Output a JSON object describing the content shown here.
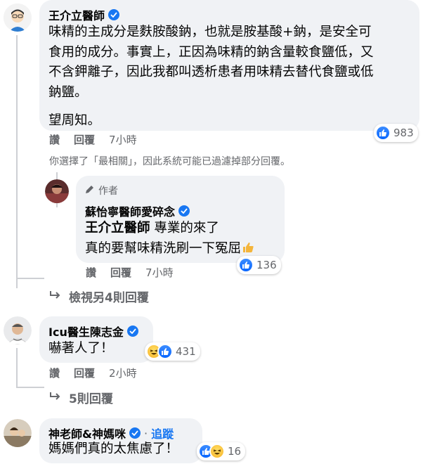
{
  "comments": [
    {
      "author": "王介立醫師",
      "text_lines": [
        "味精的主成分是麩胺酸鈉，也就是胺基酸+鈉，是安全可",
        "食用的成分。事實上，正因為味精的鈉含量較食鹽低，又",
        "不含鉀離子，因此我都叫透析患者用味精去替代食鹽或低",
        "鈉鹽。"
      ],
      "text_last": "望周知。",
      "like_label": "讚",
      "reply_label": "回覆",
      "time": "7小時",
      "reaction_count": "983"
    },
    {
      "author": "Icu醫生陳志金",
      "text": "嚇著人了！",
      "like_label": "讚",
      "reply_label": "回覆",
      "time": "2小時",
      "reaction_count": "431"
    },
    {
      "author": "神老師&神媽咪",
      "follow_label": "追蹤",
      "text": "媽媽們真的太焦慮了！",
      "reaction_count": "16"
    }
  ],
  "filter_notice": "你選擇了「最相關」，因此系統可能已過濾掉部分回覆。",
  "reply": {
    "author_badge": "作者",
    "author": "蘇怡寧醫師愛碎念",
    "mention": "王介立醫師",
    "text1_suffix": " 專業的來了",
    "text2": "真的要幫味精洗刷一下冤屈",
    "like_label": "讚",
    "reply_label": "回覆",
    "time": "7小時",
    "reaction_count": "136"
  },
  "view_more": "檢視另4則回覆",
  "more_replies": "5則回覆",
  "colors": {
    "blue": "#1877f2",
    "bubble": "#f0f2f5",
    "meta": "#65676b"
  }
}
